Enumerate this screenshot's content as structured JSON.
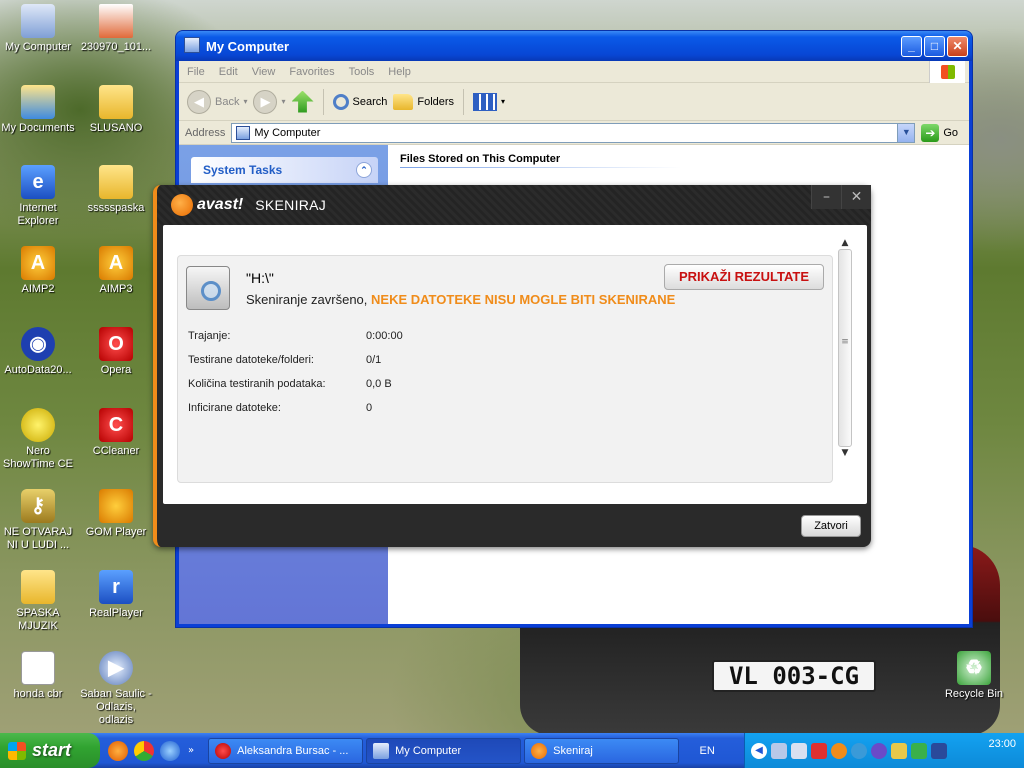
{
  "desktop": {
    "icons_left": [
      {
        "label": "My Computer",
        "glyph": "computer-icon"
      },
      {
        "label": "My Documents",
        "glyph": "documents-folder-icon"
      },
      {
        "label": "Internet Explorer",
        "glyph": "internet-explorer-icon"
      },
      {
        "label": "AIMP2",
        "glyph": "aimp-icon"
      },
      {
        "label": "AutoData20...",
        "glyph": "autodata-icon"
      },
      {
        "label": "Nero ShowTime CE",
        "glyph": "nero-icon"
      },
      {
        "label": "NE OTVARAJ NI U LUDI ...",
        "glyph": "keys-icon"
      },
      {
        "label": "SPASKA MJUZIK",
        "glyph": "folder-icon"
      },
      {
        "label": "honda cbr",
        "glyph": "word-doc-icon"
      }
    ],
    "icons_second": [
      {
        "label": "230970_101...",
        "glyph": "image-file-icon"
      },
      {
        "label": "SLUSANO",
        "glyph": "folder-icon"
      },
      {
        "label": "ssssspaska",
        "glyph": "folder-icon"
      },
      {
        "label": "AIMP3",
        "glyph": "aimp-icon"
      },
      {
        "label": "Opera",
        "glyph": "opera-icon"
      },
      {
        "label": "CCleaner",
        "glyph": "ccleaner-icon"
      },
      {
        "label": "GOM Player",
        "glyph": "gom-player-icon"
      },
      {
        "label": "RealPlayer",
        "glyph": "realplayer-icon"
      },
      {
        "label": "Saban Saulic - Odlazis, odlazis",
        "glyph": "media-file-icon"
      }
    ],
    "recycle_bin": "Recycle Bin",
    "plate": "VL 003-CG"
  },
  "explorer": {
    "title": "My Computer",
    "menu": [
      "File",
      "Edit",
      "View",
      "Favorites",
      "Tools",
      "Help"
    ],
    "toolbar": {
      "back": "Back",
      "search": "Search",
      "folders": "Folders"
    },
    "address_label": "Address",
    "address_value": "My Computer",
    "go_label": "Go",
    "tasks_header": "System Tasks",
    "files_title": "Files Stored on This Computer"
  },
  "avast": {
    "brand": "avast!",
    "heading": "SKENIRAJ",
    "drive": "\"H:\\\"",
    "status_prefix": "Skeniranje završeno, ",
    "status_warning": "NEKE DATOTEKE NISU MOGLE BITI SKENIRANE",
    "results_button": "PRIKAŽI REZULTATE",
    "stats": [
      {
        "label": "Trajanje:",
        "value": "0:00:00"
      },
      {
        "label": "Testirane datoteke/folderi:",
        "value": "0/1"
      },
      {
        "label": "Količina testiranih podataka:",
        "value": "0,0 B"
      },
      {
        "label": "Inficirane datoteke:",
        "value": "0"
      }
    ],
    "close_button": "Zatvori",
    "accent_color": "#f08c1a"
  },
  "taskbar": {
    "start": "start",
    "tasks": [
      {
        "label": "Aleksandra Bursac - ...",
        "icon": "opera-icon"
      },
      {
        "label": "My Computer",
        "icon": "computer-icon"
      },
      {
        "label": "Skeniraj",
        "icon": "avast-icon"
      }
    ],
    "language": "EN",
    "clock": "23:00"
  }
}
